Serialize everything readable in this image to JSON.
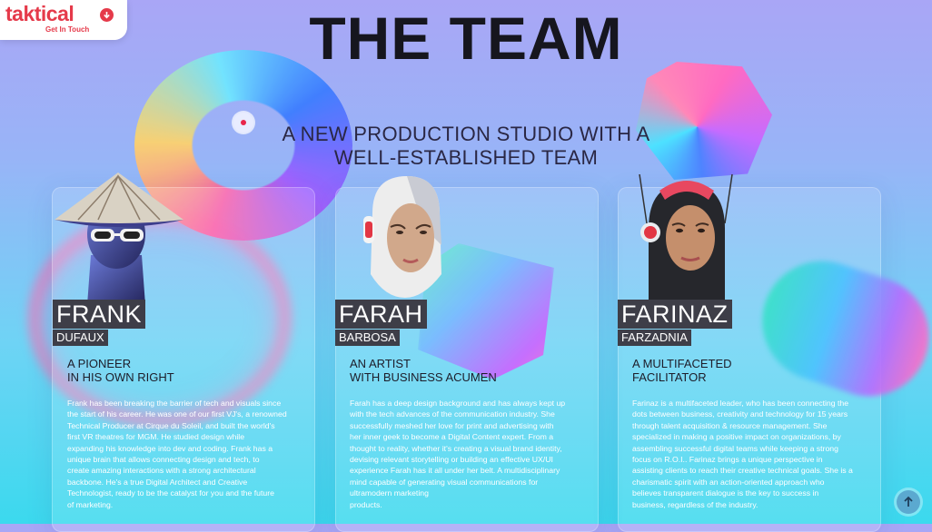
{
  "logo": {
    "text": "taktical",
    "cta": "Get In Touch",
    "icon": "arrow-down-circle-icon",
    "color": "#e53a4a"
  },
  "page": {
    "title": "THE TEAM",
    "subtitle_lines": [
      "A NEW PRODUCTION STUDIO WITH A",
      "WELL-ESTABLISHED TEAM"
    ]
  },
  "team": [
    {
      "first_name": "FRANK",
      "last_name": "DUFAUX",
      "role_lines": [
        "A PIONEER",
        "IN HIS OWN RIGHT"
      ],
      "bio_lines": [
        "Frank has been breaking the barrier of tech and visuals since",
        "the start of his career. He was one of our first VJ's, a renowned",
        "Technical Producer at Cirque du Soleil, and built the world's",
        "first VR theatres for MGM. He studied design while",
        "expanding his knowledge into dev and coding. Frank has a",
        "unique brain that allows connecting design and tech, to",
        "create amazing interactions with a strong architectural",
        "backbone. He's a true Digital Architect and Creative",
        "Technologist, ready to be the catalyst for you and the future",
        "of marketing."
      ]
    },
    {
      "first_name": "FARAH",
      "last_name": "BARBOSA",
      "role_lines": [
        "AN ARTIST",
        "WITH BUSINESS ACUMEN"
      ],
      "bio_lines": [
        "Farah has a deep design background and has always kept up",
        "with the tech advances of the communication industry. She",
        "successfully meshed her love for print and advertising with",
        "her inner geek to become a Digital Content expert. From a",
        "thought to reality, whether it's creating a visual brand identity,",
        "devising relevant storytelling or building an effective UX/UI",
        "experience Farah has it all under her belt. A multidisciplinary",
        "mind capable of generating visual communications for",
        "ultramodern marketing",
        "products."
      ]
    },
    {
      "first_name": "FARINAZ",
      "last_name": "FARZADNIA",
      "role_lines": [
        "A MULTIFACETED",
        "FACILITATOR"
      ],
      "bio_lines": [
        "Farinaz is a multifaceted leader, who has been connecting the",
        "dots between business, creativity and technology for 15 years",
        "through talent acquisition & resource management. She",
        "specialized in making a positive impact on organizations, by",
        "assembling successful digital teams while keeping a strong",
        "focus on R.O.I.. Farinaz brings a unique perspective in",
        "assisting clients to reach their creative technical goals. She is a",
        "charismatic spirit with an action-oriented approach who",
        "believes transparent dialogue is the key to success in",
        "business, regardless of the industry."
      ]
    }
  ],
  "scroll_top": {
    "icon": "arrow-up-icon"
  }
}
